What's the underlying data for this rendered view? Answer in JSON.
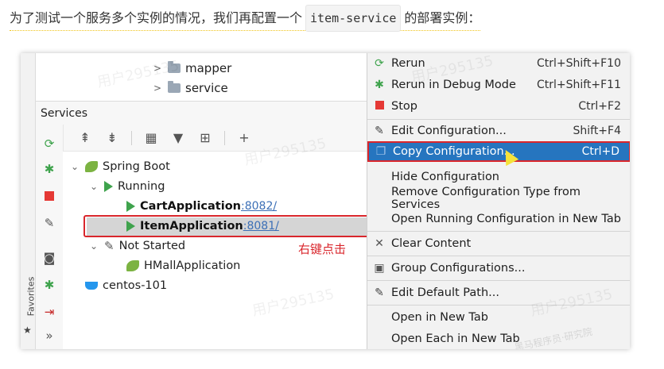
{
  "intro": {
    "before": "为了测试一个服务多个实例的情况，我们再配置一个",
    "code": "item-service",
    "after": "的部署实例："
  },
  "project_tree": [
    {
      "label": "mapper",
      "icon": "folder-icon"
    },
    {
      "label": "service",
      "icon": "folder-icon"
    }
  ],
  "services_panel": {
    "title": "Services",
    "favorites": "Favorites",
    "nodes": {
      "spring_boot": "Spring Boot",
      "running": "Running",
      "cart_app": "CartApplication",
      "cart_port": ":8082/",
      "item_app": "ItemApplication",
      "item_port": ":8081/",
      "not_started": "Not Started",
      "hmall_app": "HMallApplication",
      "centos": "centos-101"
    }
  },
  "annotation": "右键点击",
  "context_menu": {
    "rerun": {
      "label": "Rerun",
      "shortcut": "Ctrl+Shift+F10"
    },
    "rerun_debug": {
      "label": "Rerun in Debug Mode",
      "shortcut": "Ctrl+Shift+F11"
    },
    "stop": {
      "label": "Stop",
      "shortcut": "Ctrl+F2"
    },
    "edit_config": {
      "label": "Edit Configuration...",
      "shortcut": "Shift+F4"
    },
    "copy_config": {
      "label": "Copy Configuration...",
      "shortcut": "Ctrl+D"
    },
    "hide_config": {
      "label": "Hide Configuration"
    },
    "remove_type": {
      "label": "Remove Configuration Type from Services"
    },
    "open_running": {
      "label": "Open Running Configuration in New Tab"
    },
    "clear_content": {
      "label": "Clear Content"
    },
    "group_configs": {
      "label": "Group Configurations..."
    },
    "edit_default_path": {
      "label": "Edit Default Path..."
    },
    "open_new_tab": {
      "label": "Open in New Tab"
    },
    "open_each": {
      "label": "Open Each in New Tab"
    }
  },
  "watermarks": [
    "用户295135",
    "黑马程序员·研究院"
  ],
  "colors": {
    "selection": "#2675bf",
    "highlight_box": "#d9262c",
    "run_green": "#3fa34d"
  }
}
